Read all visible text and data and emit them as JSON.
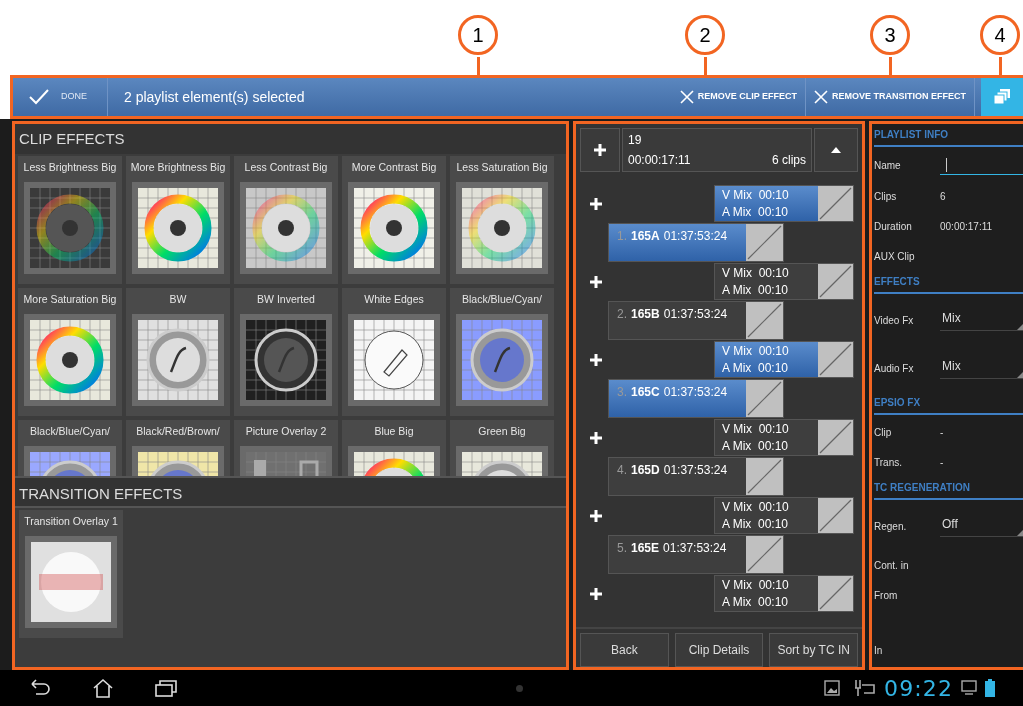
{
  "callouts": [
    "1",
    "2",
    "3",
    "4"
  ],
  "action_bar": {
    "done": "DONE",
    "title": "2 playlist element(s) selected",
    "actions": [
      "REMOVE CLIP EFFECT",
      "REMOVE TRANSITION EFFECT"
    ]
  },
  "clip_effects": {
    "title": "CLIP EFFECTS",
    "items": [
      {
        "label": "Less Brightness Big",
        "kind": "wheel-dark",
        "color": "#3a3a3a"
      },
      {
        "label": "More Brightness Big",
        "kind": "wheel",
        "color": "#e8e8dc"
      },
      {
        "label": "Less Contrast Big",
        "kind": "wheel-faded",
        "color": "#c8c8c8"
      },
      {
        "label": "More Contrast Big",
        "kind": "wheel",
        "color": "#f0f0e8"
      },
      {
        "label": "Less Saturation Big",
        "kind": "wheel-faded",
        "color": "#e0e0d8"
      },
      {
        "label": "More Saturation Big",
        "kind": "wheel",
        "color": "#e8e8dc"
      },
      {
        "label": "BW",
        "kind": "metal",
        "color": "#e0e0e0"
      },
      {
        "label": "BW Inverted",
        "kind": "metal-dark",
        "color": "#202020"
      },
      {
        "label": "White Edges",
        "kind": "sketch",
        "color": "#f4f4f4"
      },
      {
        "label": "Black/Blue/Cyan/",
        "kind": "tint",
        "color": "#8a9cff"
      },
      {
        "label": "Black/Blue/Cyan/",
        "kind": "tint",
        "color": "#9aa8ff"
      },
      {
        "label": "Black/Red/Brown/",
        "kind": "tint",
        "color": "#f0e6a8"
      },
      {
        "label": "Picture Overlay 2",
        "kind": "overlay",
        "color": "#707070"
      },
      {
        "label": "Blue Big",
        "kind": "wheel",
        "color": "#e8e8dc"
      },
      {
        "label": "Green Big",
        "kind": "metal",
        "color": "#e8e8dc"
      }
    ]
  },
  "transition_effects": {
    "title": "TRANSITION EFFECTS",
    "items": [
      {
        "label": "Transition Overlay 1",
        "kind": "burst",
        "color": "#e0e0e0"
      }
    ]
  },
  "playlist": {
    "number": "19",
    "duration": "00:00:17:11",
    "clip_count": "6 clips",
    "entries": [
      {
        "kind": "transition",
        "video": "V Mix  00:10",
        "audio": "A Mix  00:10",
        "selected": true
      },
      {
        "kind": "clip",
        "index": "1.",
        "name": "165A",
        "timecode": "01:37:53:24",
        "selected": true
      },
      {
        "kind": "transition",
        "video": "V Mix  00:10",
        "audio": "A Mix  00:10",
        "selected": false
      },
      {
        "kind": "clip",
        "index": "2.",
        "name": "165B",
        "timecode": "01:37:53:24",
        "selected": false
      },
      {
        "kind": "transition",
        "video": "V Mix  00:10",
        "audio": "A Mix  00:10",
        "selected": true
      },
      {
        "kind": "clip",
        "index": "3.",
        "name": "165C",
        "timecode": "01:37:53:24",
        "selected": true
      },
      {
        "kind": "transition",
        "video": "V Mix  00:10",
        "audio": "A Mix  00:10",
        "selected": false
      },
      {
        "kind": "clip",
        "index": "4.",
        "name": "165D",
        "timecode": "01:37:53:24",
        "selected": false
      },
      {
        "kind": "transition",
        "video": "V Mix  00:10",
        "audio": "A Mix  00:10",
        "selected": false
      },
      {
        "kind": "clip",
        "index": "5.",
        "name": "165E",
        "timecode": "01:37:53:24",
        "selected": false
      },
      {
        "kind": "transition",
        "video": "V Mix  00:10",
        "audio": "A Mix  00:10",
        "selected": false
      }
    ],
    "buttons": [
      "Back",
      "Clip Details",
      "Sort by TC IN"
    ]
  },
  "info_panel": [
    {
      "title": "PLAYLIST INFO",
      "rows": [
        {
          "label": "Name",
          "kind": "input"
        },
        {
          "label": "Clips",
          "kind": "text",
          "value": "6"
        },
        {
          "label": "Duration",
          "kind": "text",
          "value": "00:00:17:11"
        },
        {
          "label": "AUX Clip",
          "kind": "text"
        }
      ]
    },
    {
      "title": "EFFECTS",
      "rows": [
        {
          "label": "Video Fx",
          "kind": "dropdown",
          "value": "Mix"
        },
        {
          "label": "Audio Fx",
          "kind": "dropdown",
          "value": "Mix"
        }
      ]
    },
    {
      "title": "EPSIO FX",
      "rows": [
        {
          "label": "Clip",
          "kind": "text",
          "value": "-"
        },
        {
          "label": "Trans.",
          "kind": "text",
          "value": "-"
        }
      ]
    },
    {
      "title": "TC REGENERATION",
      "rows": [
        {
          "label": "Regen.",
          "kind": "dropdown",
          "value": "Off"
        },
        {
          "label": "Cont. in",
          "kind": "text"
        },
        {
          "label": "From",
          "kind": "text"
        },
        {
          "label": "In",
          "kind": "text"
        }
      ]
    }
  ],
  "status_bar": {
    "time": "09:22"
  }
}
